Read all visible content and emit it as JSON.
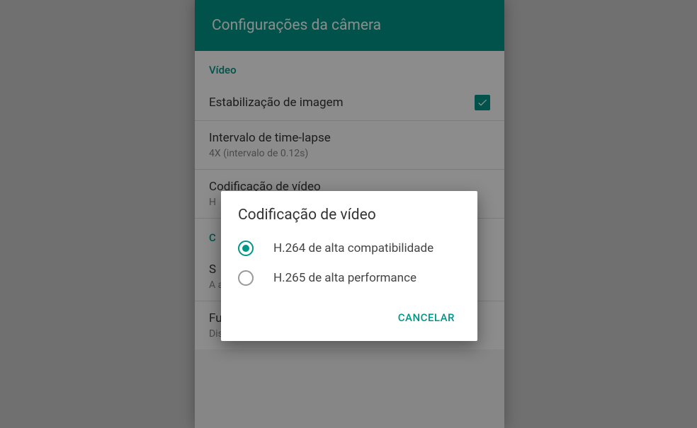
{
  "header": {
    "title": "Configurações da câmera"
  },
  "settings": {
    "section_video": "Vídeo",
    "image_stabilization": "Estabilização de imagem",
    "timelapse_title": "Intervalo de time-lapse",
    "timelapse_subtitle": "4X (intervalo de 0.12s)",
    "video_encoding_title": "Codificação de vídeo",
    "video_encoding_subtitle": "H",
    "section_other": "C",
    "item_a_title": "S",
    "item_a_subtitle": "A a",
    "item_b_title": "Função dos botões de volume",
    "item_b_subtitle": "Disparador"
  },
  "dialog": {
    "title": "Codificação de vídeo",
    "option1": "H.264 de alta compatibilidade",
    "option2": "H.265 de alta performance",
    "cancel": "CANCELAR"
  }
}
